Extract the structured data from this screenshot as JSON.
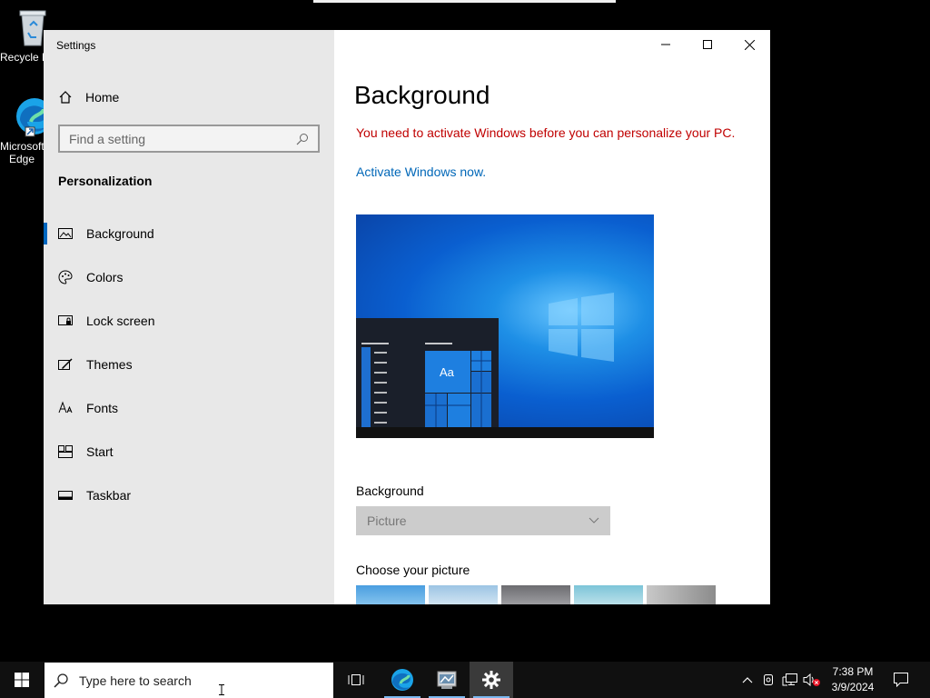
{
  "desktop": {
    "icons": [
      {
        "label": "Recycle Bin",
        "icon": "recycle-bin-icon"
      },
      {
        "label": "Microsoft Edge",
        "icon": "edge-icon"
      }
    ]
  },
  "window": {
    "title": "Settings",
    "caption_buttons": [
      "minimize-icon",
      "maximize-icon",
      "close-icon"
    ]
  },
  "sidebar": {
    "home_label": "Home",
    "search_placeholder": "Find a setting",
    "section_title": "Personalization",
    "items": [
      {
        "label": "Background",
        "icon": "picture-icon",
        "active": true
      },
      {
        "label": "Colors",
        "icon": "palette-icon",
        "active": false
      },
      {
        "label": "Lock screen",
        "icon": "lock-screen-icon",
        "active": false
      },
      {
        "label": "Themes",
        "icon": "brush-icon",
        "active": false
      },
      {
        "label": "Fonts",
        "icon": "font-icon",
        "active": false
      },
      {
        "label": "Start",
        "icon": "start-icon",
        "active": false
      },
      {
        "label": "Taskbar",
        "icon": "taskbar-icon",
        "active": false
      }
    ]
  },
  "main": {
    "title": "Background",
    "warning": "You need to activate Windows before you can personalize your PC.",
    "activate_link": "Activate Windows now.",
    "preview_tile_text": "Aa",
    "background_label": "Background",
    "background_value": "Picture",
    "choose_picture_label": "Choose your picture"
  },
  "taskbar": {
    "search_placeholder": "Type here to search",
    "time": "7:38 PM",
    "date": "3/9/2024"
  },
  "colors": {
    "accent": "#0067c0",
    "warning": "#c00000",
    "link": "#0067b8"
  }
}
